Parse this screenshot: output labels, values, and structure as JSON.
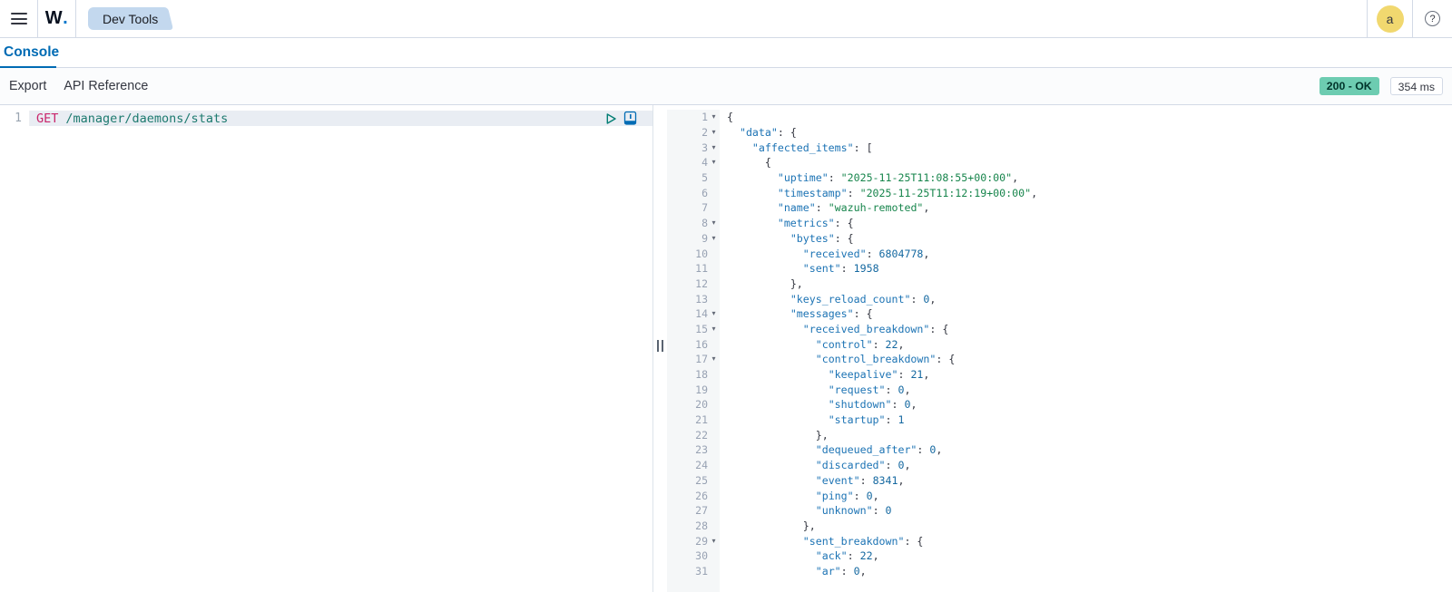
{
  "header": {
    "logo_w": "W",
    "logo_dot": ".",
    "app_tab": "Dev Tools",
    "avatar_initial": "a",
    "help_glyph": "?"
  },
  "tabs": {
    "console_label": "Console"
  },
  "toolbar": {
    "export_label": "Export",
    "api_reference_label": "API Reference",
    "status_badge": "200 - OK",
    "time_badge": "354 ms"
  },
  "request": {
    "line_number": "1",
    "method": "GET",
    "path": "/manager/daemons/stats"
  },
  "response": {
    "lines": [
      {
        "n": 1,
        "fold": true,
        "indent": 0,
        "tokens": [
          [
            "p",
            "{"
          ]
        ]
      },
      {
        "n": 2,
        "fold": true,
        "indent": 2,
        "tokens": [
          [
            "k",
            "\"data\""
          ],
          [
            "p",
            ": {"
          ]
        ]
      },
      {
        "n": 3,
        "fold": true,
        "indent": 4,
        "tokens": [
          [
            "k",
            "\"affected_items\""
          ],
          [
            "p",
            ": ["
          ]
        ]
      },
      {
        "n": 4,
        "fold": true,
        "indent": 6,
        "tokens": [
          [
            "p",
            "{"
          ]
        ]
      },
      {
        "n": 5,
        "fold": false,
        "indent": 8,
        "tokens": [
          [
            "k",
            "\"uptime\""
          ],
          [
            "p",
            ": "
          ],
          [
            "s",
            "\"2025-11-25T11:08:55+00:00\""
          ],
          [
            "p",
            ","
          ]
        ]
      },
      {
        "n": 6,
        "fold": false,
        "indent": 8,
        "tokens": [
          [
            "k",
            "\"timestamp\""
          ],
          [
            "p",
            ": "
          ],
          [
            "s",
            "\"2025-11-25T11:12:19+00:00\""
          ],
          [
            "p",
            ","
          ]
        ]
      },
      {
        "n": 7,
        "fold": false,
        "indent": 8,
        "tokens": [
          [
            "k",
            "\"name\""
          ],
          [
            "p",
            ": "
          ],
          [
            "s",
            "\"wazuh-remoted\""
          ],
          [
            "p",
            ","
          ]
        ]
      },
      {
        "n": 8,
        "fold": true,
        "indent": 8,
        "tokens": [
          [
            "k",
            "\"metrics\""
          ],
          [
            "p",
            ": {"
          ]
        ]
      },
      {
        "n": 9,
        "fold": true,
        "indent": 10,
        "tokens": [
          [
            "k",
            "\"bytes\""
          ],
          [
            "p",
            ": {"
          ]
        ]
      },
      {
        "n": 10,
        "fold": false,
        "indent": 12,
        "tokens": [
          [
            "k",
            "\"received\""
          ],
          [
            "p",
            ": "
          ],
          [
            "n",
            "6804778"
          ],
          [
            "p",
            ","
          ]
        ]
      },
      {
        "n": 11,
        "fold": false,
        "indent": 12,
        "tokens": [
          [
            "k",
            "\"sent\""
          ],
          [
            "p",
            ": "
          ],
          [
            "n",
            "1958"
          ]
        ]
      },
      {
        "n": 12,
        "fold": false,
        "indent": 10,
        "tokens": [
          [
            "p",
            "},"
          ]
        ]
      },
      {
        "n": 13,
        "fold": false,
        "indent": 10,
        "tokens": [
          [
            "k",
            "\"keys_reload_count\""
          ],
          [
            "p",
            ": "
          ],
          [
            "n",
            "0"
          ],
          [
            "p",
            ","
          ]
        ]
      },
      {
        "n": 14,
        "fold": true,
        "indent": 10,
        "tokens": [
          [
            "k",
            "\"messages\""
          ],
          [
            "p",
            ": {"
          ]
        ]
      },
      {
        "n": 15,
        "fold": true,
        "indent": 12,
        "tokens": [
          [
            "k",
            "\"received_breakdown\""
          ],
          [
            "p",
            ": {"
          ]
        ]
      },
      {
        "n": 16,
        "fold": false,
        "indent": 14,
        "tokens": [
          [
            "k",
            "\"control\""
          ],
          [
            "p",
            ": "
          ],
          [
            "n",
            "22"
          ],
          [
            "p",
            ","
          ]
        ]
      },
      {
        "n": 17,
        "fold": true,
        "indent": 14,
        "tokens": [
          [
            "k",
            "\"control_breakdown\""
          ],
          [
            "p",
            ": {"
          ]
        ]
      },
      {
        "n": 18,
        "fold": false,
        "indent": 16,
        "tokens": [
          [
            "k",
            "\"keepalive\""
          ],
          [
            "p",
            ": "
          ],
          [
            "n",
            "21"
          ],
          [
            "p",
            ","
          ]
        ]
      },
      {
        "n": 19,
        "fold": false,
        "indent": 16,
        "tokens": [
          [
            "k",
            "\"request\""
          ],
          [
            "p",
            ": "
          ],
          [
            "n",
            "0"
          ],
          [
            "p",
            ","
          ]
        ]
      },
      {
        "n": 20,
        "fold": false,
        "indent": 16,
        "tokens": [
          [
            "k",
            "\"shutdown\""
          ],
          [
            "p",
            ": "
          ],
          [
            "n",
            "0"
          ],
          [
            "p",
            ","
          ]
        ]
      },
      {
        "n": 21,
        "fold": false,
        "indent": 16,
        "tokens": [
          [
            "k",
            "\"startup\""
          ],
          [
            "p",
            ": "
          ],
          [
            "n",
            "1"
          ]
        ]
      },
      {
        "n": 22,
        "fold": false,
        "indent": 14,
        "tokens": [
          [
            "p",
            "},"
          ]
        ]
      },
      {
        "n": 23,
        "fold": false,
        "indent": 14,
        "tokens": [
          [
            "k",
            "\"dequeued_after\""
          ],
          [
            "p",
            ": "
          ],
          [
            "n",
            "0"
          ],
          [
            "p",
            ","
          ]
        ]
      },
      {
        "n": 24,
        "fold": false,
        "indent": 14,
        "tokens": [
          [
            "k",
            "\"discarded\""
          ],
          [
            "p",
            ": "
          ],
          [
            "n",
            "0"
          ],
          [
            "p",
            ","
          ]
        ]
      },
      {
        "n": 25,
        "fold": false,
        "indent": 14,
        "tokens": [
          [
            "k",
            "\"event\""
          ],
          [
            "p",
            ": "
          ],
          [
            "n",
            "8341"
          ],
          [
            "p",
            ","
          ]
        ]
      },
      {
        "n": 26,
        "fold": false,
        "indent": 14,
        "tokens": [
          [
            "k",
            "\"ping\""
          ],
          [
            "p",
            ": "
          ],
          [
            "n",
            "0"
          ],
          [
            "p",
            ","
          ]
        ]
      },
      {
        "n": 27,
        "fold": false,
        "indent": 14,
        "tokens": [
          [
            "k",
            "\"unknown\""
          ],
          [
            "p",
            ": "
          ],
          [
            "n",
            "0"
          ]
        ]
      },
      {
        "n": 28,
        "fold": false,
        "indent": 12,
        "tokens": [
          [
            "p",
            "},"
          ]
        ]
      },
      {
        "n": 29,
        "fold": true,
        "indent": 12,
        "tokens": [
          [
            "k",
            "\"sent_breakdown\""
          ],
          [
            "p",
            ": {"
          ]
        ]
      },
      {
        "n": 30,
        "fold": false,
        "indent": 14,
        "tokens": [
          [
            "k",
            "\"ack\""
          ],
          [
            "p",
            ": "
          ],
          [
            "n",
            "22"
          ],
          [
            "p",
            ","
          ]
        ]
      },
      {
        "n": 31,
        "fold": false,
        "indent": 14,
        "tokens": [
          [
            "k",
            "\"ar\""
          ],
          [
            "p",
            ": "
          ],
          [
            "n",
            "0"
          ],
          [
            "p",
            ","
          ]
        ]
      }
    ]
  },
  "icons": {
    "fold_arrow": "▾"
  },
  "colors": {
    "primary": "#006BB4",
    "border": "#d3dae6",
    "text": "#343741",
    "tok_key": "#1c73b4",
    "tok_string": "#17854c",
    "tok_number": "#1468a0",
    "tok_punct": "#343741",
    "tok_method": "#c9256b",
    "tok_path": "#1d7a6f",
    "badge_success_bg": "#6dccb1",
    "avatar_bg": "#f1d86f",
    "devtools_tab_bg": "#c3d8ee",
    "active_line_bg": "#e9edf3",
    "gutter_bg": "#f5f7f8",
    "line_number": "#98a2b3"
  }
}
